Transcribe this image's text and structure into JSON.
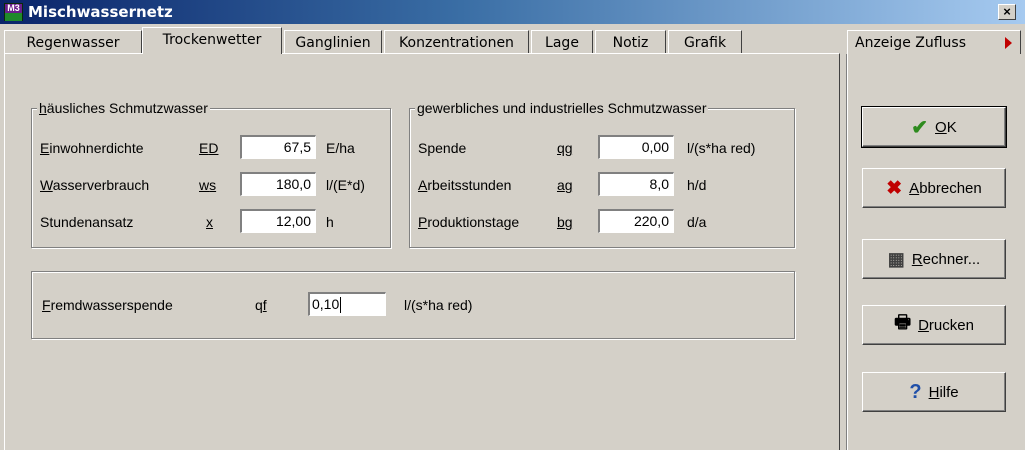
{
  "window": {
    "title": "Mischwassernetz",
    "close_label": "×",
    "icon_top": "M3",
    "icon_bottom": ""
  },
  "tabs": [
    {
      "label": "Regenwasser",
      "active": false
    },
    {
      "label": "Trockenwetter",
      "active": true
    },
    {
      "label": "Ganglinien",
      "active": false
    },
    {
      "label": "Konzentrationen",
      "active": false
    },
    {
      "label": "Lage",
      "active": false
    },
    {
      "label": "Notiz",
      "active": false
    },
    {
      "label": "Grafik",
      "active": false
    }
  ],
  "side_tab": {
    "label": "Anzeige Zufluss",
    "arrow_color": "#c00000"
  },
  "domestic": {
    "legend_first": "h",
    "legend_rest": "äusliches Schmutzwasser",
    "rows": [
      {
        "label_u": "E",
        "label_rest": "inwohnerdichte",
        "sym_u": "E",
        "sym_rest": "D",
        "value": "67,5",
        "unit": "E/ha"
      },
      {
        "label_u": "W",
        "label_rest": "asserverbrauch",
        "sym_u": "w",
        "sym_rest": "s",
        "value": "180,0",
        "unit": "l/(E*d)"
      },
      {
        "label_u": "",
        "label_rest": "Stundenansatz",
        "sym_u": "x",
        "sym_rest": "",
        "value": "12,00",
        "unit": "h"
      }
    ]
  },
  "industrial": {
    "legend_first": "g",
    "legend_rest": "ewerbliches und industrielles Schmutzwasser",
    "rows": [
      {
        "label_u": "",
        "label_rest": "Spende",
        "sym_u": "q",
        "sym_rest": "g",
        "value": "0,00",
        "unit": "l/(s*ha red)"
      },
      {
        "label_u": "A",
        "label_rest": "rbeitsstunden",
        "sym_u": "a",
        "sym_rest": "g",
        "value": "8,0",
        "unit": "h/d"
      },
      {
        "label_u": "P",
        "label_rest": "roduktionstage",
        "sym_u": "b",
        "sym_rest": "g",
        "value": "220,0",
        "unit": "d/a"
      }
    ]
  },
  "foreign_water": {
    "label_u": "F",
    "label_rest": "remdwasserspende",
    "sym_first": "q",
    "sym_u": "f",
    "value": "0,10",
    "unit": "l/(s*ha red)"
  },
  "buttons": [
    {
      "name": "ok-button",
      "icon": "check-icon",
      "glyph": "✔",
      "color": "#2e8b1e",
      "label_u": "O",
      "label_rest": "K"
    },
    {
      "name": "cancel-button",
      "icon": "cross-icon",
      "glyph": "✖",
      "color": "#c00000",
      "label_u": "A",
      "label_rest": "bbrechen"
    },
    {
      "name": "calculator-button",
      "icon": "calculator-icon",
      "glyph": "▦",
      "color": "#404040",
      "label_u": "R",
      "label_rest": "echner..."
    },
    {
      "name": "print-button",
      "icon": "printer-icon",
      "glyph": "🖶",
      "color": "#000000",
      "label_u": "D",
      "label_rest": "rucken"
    },
    {
      "name": "help-button",
      "icon": "question-icon",
      "glyph": "?",
      "color": "#1f4fa8",
      "label_u": "H",
      "label_rest": "ilfe"
    }
  ]
}
